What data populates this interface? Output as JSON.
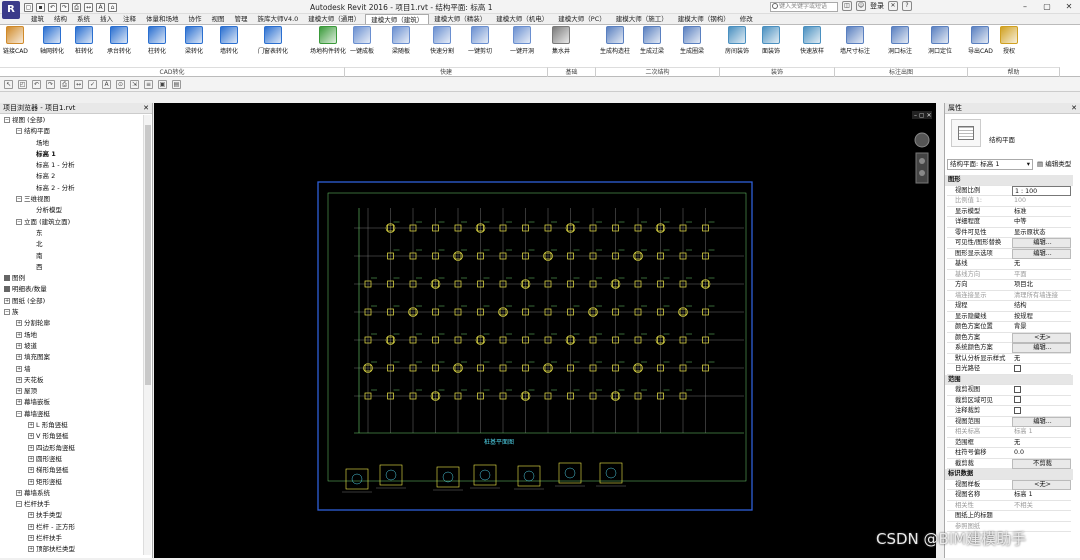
{
  "window": {
    "title": "Autodesk Revit 2016 -    项目1.rvt - 结构平面: 标高 1",
    "search_placeholder": "键入关键字或短语",
    "user": "登录"
  },
  "tabs": [
    "建筑",
    "结构",
    "系统",
    "插入",
    "注释",
    "体量和场地",
    "协作",
    "视图",
    "管理",
    "族库大师V4.0",
    "建模大师（通用）",
    "建模大师（建筑）",
    "建模大师（精装）",
    "建模大师（机电）",
    "建模大师（PC）",
    "建模大师（施工）",
    "建模大师（钢构）",
    "修改"
  ],
  "active_tab": "建模大师（建筑）",
  "ribbon": {
    "buttons": [
      {
        "label": "链接CAD",
        "color": "#d08a2a"
      },
      {
        "label": "轴网转化",
        "color": "#2a6fd0"
      },
      {
        "label": "桩转化",
        "color": "#2a6fd0"
      },
      {
        "label": "承台转化",
        "color": "#2a6fd0"
      },
      {
        "label": "柱转化",
        "color": "#2a6fd0"
      },
      {
        "label": "梁转化",
        "color": "#2a6fd0"
      },
      {
        "label": "墙转化",
        "color": "#2a6fd0"
      },
      {
        "label": "门窗表转化",
        "color": "#2a6fd0"
      },
      {
        "label": "场地构件转化",
        "color": "#3a9a3a"
      },
      {
        "label": "一键成板",
        "color": "#6a8fd0"
      },
      {
        "label": "梁随板",
        "color": "#6a8fd0"
      },
      {
        "label": "快速分割",
        "color": "#6a8fd0"
      },
      {
        "label": "一键剪切",
        "color": "#6a8fd0"
      },
      {
        "label": "一键开洞",
        "color": "#6a8fd0"
      },
      {
        "label": "集水井",
        "color": "#7a7a7a"
      },
      {
        "label": "生成构造柱",
        "color": "#5a80c0"
      },
      {
        "label": "生成过梁",
        "color": "#5a80c0"
      },
      {
        "label": "生成圈梁",
        "color": "#5a80c0"
      },
      {
        "label": "房间装饰",
        "color": "#4a90c0"
      },
      {
        "label": "面装饰",
        "color": "#4a90c0"
      },
      {
        "label": "快速放样",
        "color": "#4a90c0"
      },
      {
        "label": "墙尺寸标注",
        "color": "#5a80c0"
      },
      {
        "label": "洞口标注",
        "color": "#5a80c0"
      },
      {
        "label": "洞口定位",
        "color": "#5a80c0"
      },
      {
        "label": "导出CAD",
        "color": "#5a80c0"
      },
      {
        "label": "授权",
        "color": "#d0a020"
      }
    ],
    "groups": [
      "CAD转化",
      "快建",
      "基础",
      "二次结构",
      "装饰",
      "标注出图",
      "帮助"
    ]
  },
  "browser": {
    "title": "项目浏览器 - 项目1.rvt",
    "items": [
      {
        "t": "视图 (全部)",
        "lv": 0,
        "ex": "−"
      },
      {
        "t": "结构平面",
        "lv": 1,
        "ex": "−"
      },
      {
        "t": "场地",
        "lv": 2
      },
      {
        "t": "标高 1",
        "lv": 2,
        "bold": true
      },
      {
        "t": "标高 1 - 分析",
        "lv": 2
      },
      {
        "t": "标高 2",
        "lv": 2
      },
      {
        "t": "标高 2 - 分析",
        "lv": 2
      },
      {
        "t": "三维视图",
        "lv": 1,
        "ex": "−"
      },
      {
        "t": "分析模型",
        "lv": 2
      },
      {
        "t": "立面 (建筑立面)",
        "lv": 1,
        "ex": "−"
      },
      {
        "t": "东",
        "lv": 2
      },
      {
        "t": "北",
        "lv": 2
      },
      {
        "t": "南",
        "lv": 2
      },
      {
        "t": "西",
        "lv": 2
      },
      {
        "t": "图例",
        "lv": 0
      },
      {
        "t": "明细表/数量",
        "lv": 0
      },
      {
        "t": "图纸 (全部)",
        "lv": 0,
        "ex": "+"
      },
      {
        "t": "族",
        "lv": 0,
        "ex": "−"
      },
      {
        "t": "分割轮廓",
        "lv": 1,
        "ex": "+"
      },
      {
        "t": "场地",
        "lv": 1,
        "ex": "+"
      },
      {
        "t": "坡道",
        "lv": 1,
        "ex": "+"
      },
      {
        "t": "填充图案",
        "lv": 1,
        "ex": "+"
      },
      {
        "t": "墙",
        "lv": 1,
        "ex": "+"
      },
      {
        "t": "天花板",
        "lv": 1,
        "ex": "+"
      },
      {
        "t": "屋顶",
        "lv": 1,
        "ex": "+"
      },
      {
        "t": "幕墙嵌板",
        "lv": 1,
        "ex": "+"
      },
      {
        "t": "幕墙竖梃",
        "lv": 1,
        "ex": "−"
      },
      {
        "t": "L 形角竖梃",
        "lv": 2,
        "ex": "+"
      },
      {
        "t": "V 形角竖梃",
        "lv": 2,
        "ex": "+"
      },
      {
        "t": "四边形角竖梃",
        "lv": 2,
        "ex": "+"
      },
      {
        "t": "圆形竖梃",
        "lv": 2,
        "ex": "+"
      },
      {
        "t": "梯形角竖梃",
        "lv": 2,
        "ex": "+"
      },
      {
        "t": "矩形竖梃",
        "lv": 2,
        "ex": "+"
      },
      {
        "t": "幕墙系统",
        "lv": 1,
        "ex": "+"
      },
      {
        "t": "栏杆扶手",
        "lv": 1,
        "ex": "−"
      },
      {
        "t": "扶手类型",
        "lv": 2,
        "ex": "+"
      },
      {
        "t": "栏杆 - 正方形",
        "lv": 2,
        "ex": "+"
      },
      {
        "t": "栏杆扶手",
        "lv": 2,
        "ex": "+"
      },
      {
        "t": "顶部扶栏类型",
        "lv": 2,
        "ex": "+"
      }
    ]
  },
  "drawing": {
    "caption": "桩基平面图",
    "bg": "#000000",
    "border": "#2f5fd8"
  },
  "properties": {
    "title": "属性",
    "type_name": "结构平面",
    "selector": "结构平面: 标高 1",
    "edit_type": "编辑类型",
    "rows": [
      {
        "s": "图形"
      },
      {
        "l": "视图比例",
        "v": "1 : 100",
        "boxed": true
      },
      {
        "l": "比例值 1:",
        "v": "100",
        "grey": true
      },
      {
        "l": "显示模型",
        "v": "标准"
      },
      {
        "l": "详细程度",
        "v": "中等"
      },
      {
        "l": "零件可见性",
        "v": "显示原状态"
      },
      {
        "l": "可见性/图形替换",
        "v": "编辑...",
        "btn": true
      },
      {
        "l": "图形显示选项",
        "v": "编辑...",
        "btn": true
      },
      {
        "l": "基线",
        "v": "无"
      },
      {
        "l": "基线方向",
        "v": "平面",
        "grey": true
      },
      {
        "l": "方向",
        "v": "项目北"
      },
      {
        "l": "墙连接显示",
        "v": "清理所有墙连接",
        "grey": true
      },
      {
        "l": "规程",
        "v": "结构"
      },
      {
        "l": "显示隐藏线",
        "v": "按规程"
      },
      {
        "l": "颜色方案位置",
        "v": "背景"
      },
      {
        "l": "颜色方案",
        "v": "<无>",
        "btn": true
      },
      {
        "l": "系统颜色方案",
        "v": "编辑...",
        "btn": true
      },
      {
        "l": "默认分析显示样式",
        "v": "无"
      },
      {
        "l": "日光路径",
        "v": "",
        "chk": true
      },
      {
        "s": "范围"
      },
      {
        "l": "裁剪视图",
        "v": "",
        "chk": true
      },
      {
        "l": "裁剪区域可见",
        "v": "",
        "chk": true
      },
      {
        "l": "注释裁剪",
        "v": "",
        "chk": true
      },
      {
        "l": "视图范围",
        "v": "编辑...",
        "btn": true
      },
      {
        "l": "相关标高",
        "v": "标高 1",
        "grey": true
      },
      {
        "l": "范围框",
        "v": "无"
      },
      {
        "l": "柱符号偏移",
        "v": "0.0"
      },
      {
        "l": "截剪裁",
        "v": "不剪裁",
        "btn": true
      },
      {
        "s": "标识数据"
      },
      {
        "l": "视图样板",
        "v": "<无>",
        "btn": true
      },
      {
        "l": "视图名称",
        "v": "标高 1"
      },
      {
        "l": "相关性",
        "v": "不相关",
        "grey": true
      },
      {
        "l": "图纸上的标题",
        "v": ""
      },
      {
        "l": "参照图纸",
        "v": "",
        "grey": true
      }
    ]
  },
  "watermark": "CSDN @BIM建模助手"
}
